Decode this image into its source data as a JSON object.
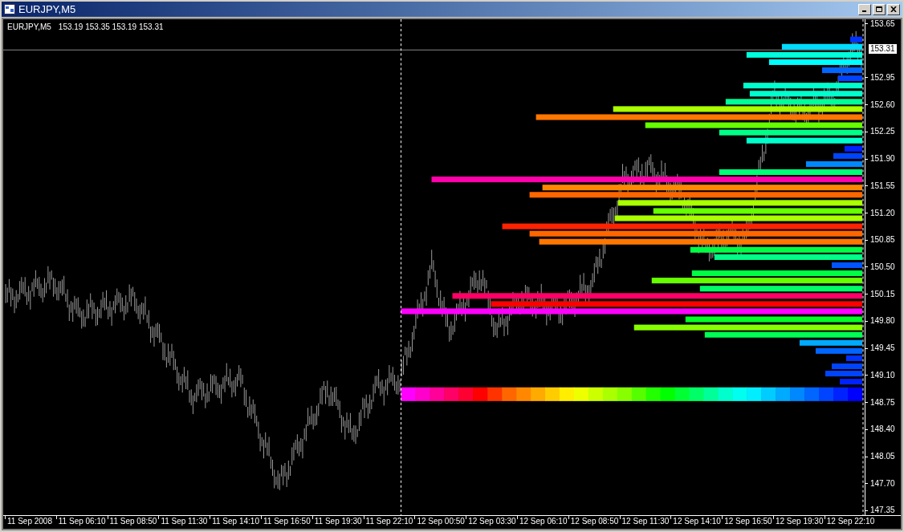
{
  "window": {
    "title": "EURJPY,M5"
  },
  "chart": {
    "symbol": "EURJPY,M5",
    "quote": "153.19 153.35 153.19 153.31",
    "current_price": "153.31",
    "price_labels": [
      "153.65",
      "152.95",
      "152.60",
      "152.25",
      "151.90",
      "151.55",
      "151.20",
      "150.85",
      "150.50",
      "150.15",
      "149.80",
      "149.45",
      "149.10",
      "148.75",
      "148.40",
      "148.05",
      "147.70",
      "147.35"
    ],
    "time_labels": [
      "11 Sep 2008",
      "11 Sep 06:10",
      "11 Sep 08:50",
      "11 Sep 11:30",
      "11 Sep 14:10",
      "11 Sep 16:50",
      "11 Sep 19:30",
      "11 Sep 22:10",
      "12 Sep 00:50",
      "12 Sep 03:30",
      "12 Sep 06:10",
      "12 Sep 08:50",
      "12 Sep 11:30",
      "12 Sep 14:10",
      "12 Sep 16:50",
      "12 Sep 19:30",
      "12 Sep 22:10"
    ]
  }
}
